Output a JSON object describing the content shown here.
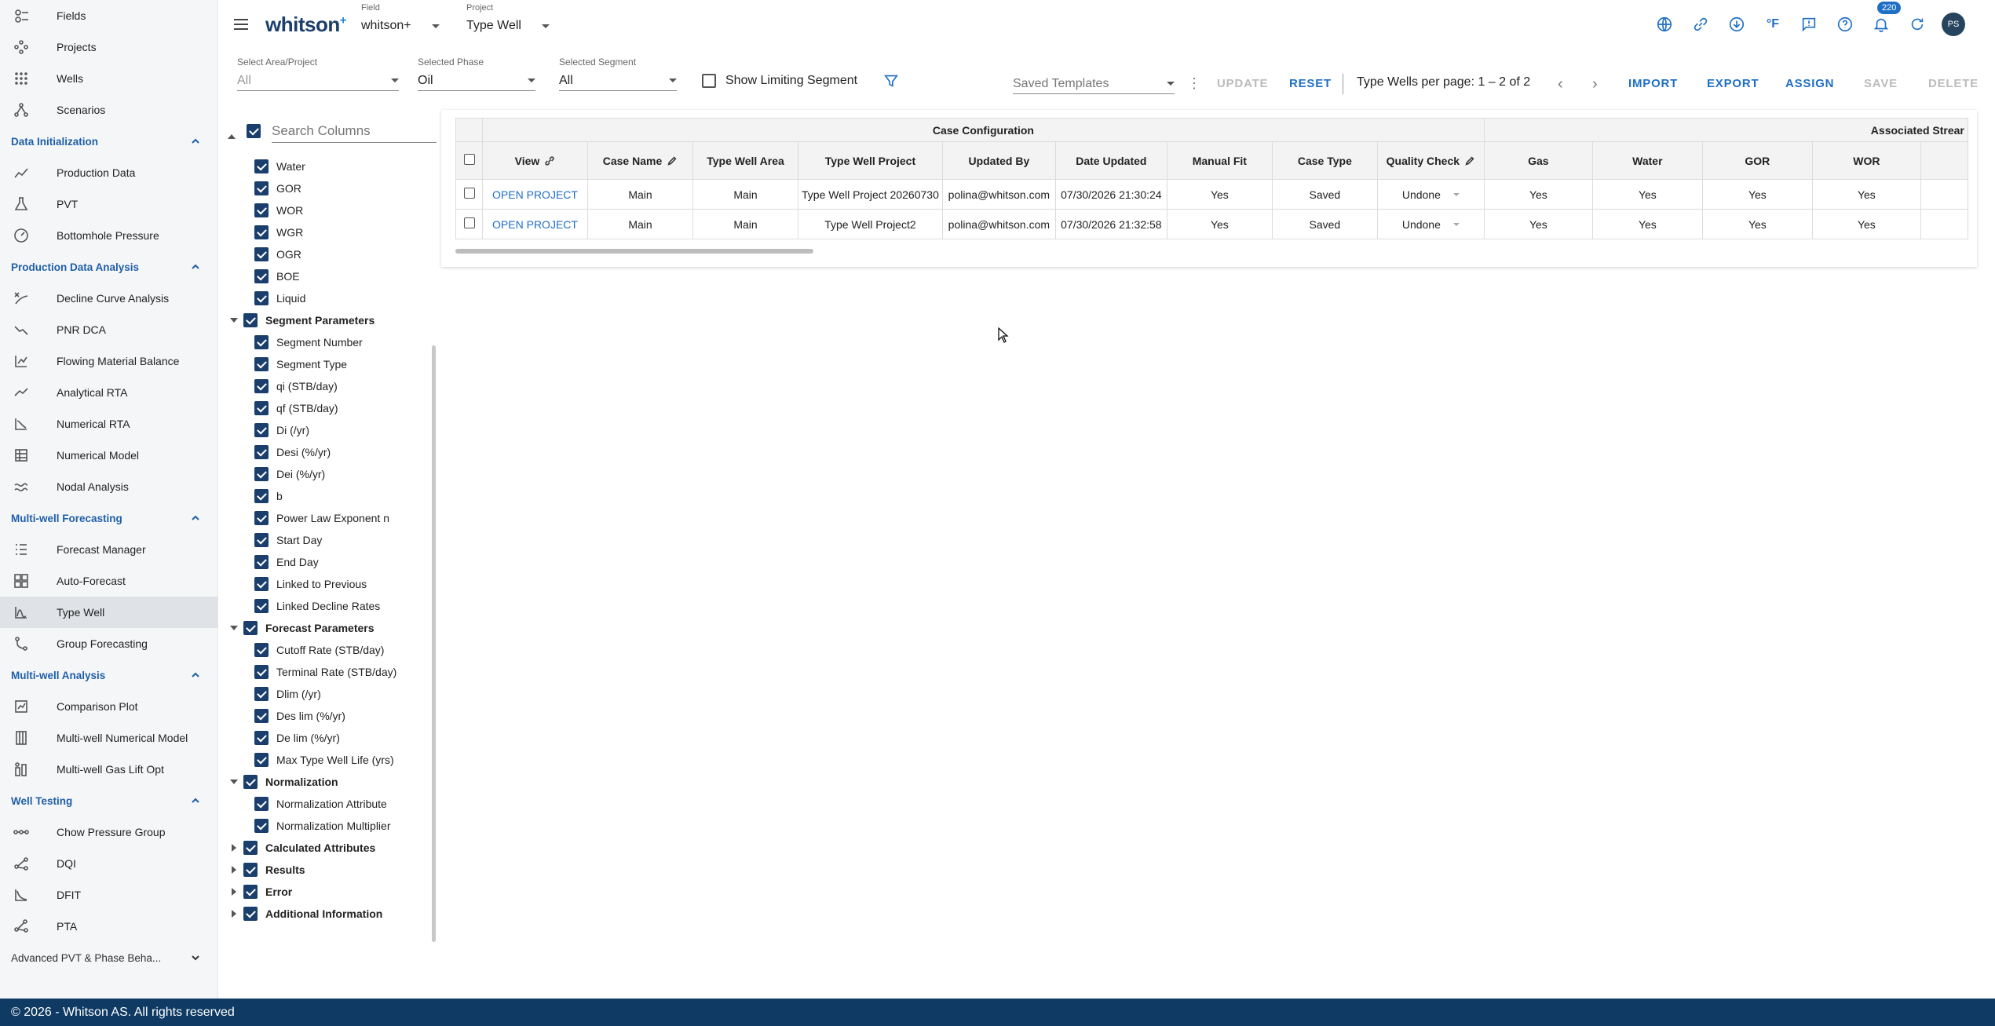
{
  "sidebar": {
    "top_items": [
      {
        "label": "Fields",
        "icon": "fields-icon"
      },
      {
        "label": "Projects",
        "icon": "projects-icon"
      },
      {
        "label": "Wells",
        "icon": "wells-icon"
      },
      {
        "label": "Scenarios",
        "icon": "scenarios-icon"
      }
    ],
    "sections": [
      {
        "title": "Data Initialization",
        "items": [
          {
            "label": "Production Data",
            "icon": "line-chart-icon"
          },
          {
            "label": "PVT",
            "icon": "flask-icon"
          },
          {
            "label": "Bottomhole Pressure",
            "icon": "gauge-icon"
          }
        ]
      },
      {
        "title": "Production Data Analysis",
        "items": [
          {
            "label": "Decline Curve Analysis",
            "icon": "decline-icon"
          },
          {
            "label": "PNR DCA",
            "icon": "trend-down-icon"
          },
          {
            "label": "Flowing Material Balance",
            "icon": "fmb-icon"
          },
          {
            "label": "Analytical RTA",
            "icon": "trend-icon"
          },
          {
            "label": "Numerical RTA",
            "icon": "numerical-rta-icon"
          },
          {
            "label": "Numerical Model",
            "icon": "grid-model-icon"
          },
          {
            "label": "Nodal Analysis",
            "icon": "nodal-icon"
          }
        ]
      },
      {
        "title": "Multi-well Forecasting",
        "items": [
          {
            "label": "Forecast Manager",
            "icon": "list-icon"
          },
          {
            "label": "Auto-Forecast",
            "icon": "auto-forecast-icon"
          },
          {
            "label": "Type Well",
            "icon": "type-well-icon",
            "active": true
          },
          {
            "label": "Group Forecasting",
            "icon": "group-icon"
          }
        ]
      },
      {
        "title": "Multi-well Analysis",
        "items": [
          {
            "label": "Comparison Plot",
            "icon": "comparison-icon"
          },
          {
            "label": "Multi-well Numerical Model",
            "icon": "multi-numerical-icon"
          },
          {
            "label": "Multi-well Gas Lift Opt",
            "icon": "gas-lift-icon"
          }
        ]
      },
      {
        "title": "Well Testing",
        "items": [
          {
            "label": "Chow Pressure Group",
            "icon": "chow-icon"
          },
          {
            "label": "DQI",
            "icon": "dqi-icon"
          },
          {
            "label": "DFIT",
            "icon": "dfit-icon"
          },
          {
            "label": "PTA",
            "icon": "pta-icon"
          }
        ]
      }
    ],
    "collapsed_section": "Advanced PVT & Phase Beha..."
  },
  "topbar": {
    "logo": "whitson",
    "logo_sup": "+",
    "field_label": "Field",
    "field_value": "whitson+",
    "project_label": "Project",
    "project_value": "Type Well",
    "temperature_unit": "°F",
    "notifications_count": "220",
    "avatar_initials": "PS"
  },
  "filters": {
    "area_label": "Select Area/Project",
    "area_value": "All",
    "phase_label": "Selected Phase",
    "phase_value": "Oil",
    "segment_label": "Selected Segment",
    "segment_value": "All",
    "show_limiting_segment": "Show Limiting Segment",
    "saved_templates": "Saved Templates",
    "update": "UPDATE",
    "reset": "RESET",
    "pager": "Type Wells per page: 1 – 2 of 2",
    "import": "IMPORT",
    "export": "EXPORT",
    "assign": "ASSIGN",
    "save": "SAVE",
    "delete": "DELETE"
  },
  "columns_panel": {
    "search_placeholder": "Search Columns",
    "groups": [
      {
        "label": null,
        "expanded": true,
        "children": [
          "Water",
          "GOR",
          "WOR",
          "WGR",
          "OGR",
          "BOE",
          "Liquid"
        ]
      },
      {
        "label": "Segment Parameters",
        "expanded": true,
        "children": [
          "Segment Number",
          "Segment Type",
          "qi (STB/day)",
          "qf (STB/day)",
          "Di (/yr)",
          "Desi (%/yr)",
          "Dei (%/yr)",
          "b",
          "Power Law Exponent n",
          "Start Day",
          "End Day",
          "Linked to Previous",
          "Linked Decline Rates"
        ]
      },
      {
        "label": "Forecast Parameters",
        "expanded": true,
        "children": [
          "Cutoff Rate (STB/day)",
          "Terminal Rate (STB/day)",
          "Dlim (/yr)",
          "Des lim (%/yr)",
          "De lim (%/yr)",
          "Max Type Well Life (yrs)"
        ]
      },
      {
        "label": "Normalization",
        "expanded": true,
        "children": [
          "Normalization Attribute",
          "Normalization Multiplier"
        ]
      },
      {
        "label": "Calculated Attributes",
        "expanded": false,
        "children": []
      },
      {
        "label": "Results",
        "expanded": false,
        "children": []
      },
      {
        "label": "Error",
        "expanded": false,
        "children": []
      },
      {
        "label": "Additional Information",
        "expanded": false,
        "children": []
      }
    ]
  },
  "table": {
    "group_headers": {
      "case_configuration": "Case Configuration",
      "associated_streams": "Associated Strear"
    },
    "headers": [
      "View",
      "Case Name",
      "Type Well Area",
      "Type Well Project",
      "Updated By",
      "Date Updated",
      "Manual Fit",
      "Case Type",
      "Quality Check",
      "Gas",
      "Water",
      "GOR",
      "WOR"
    ],
    "rows": [
      [
        "OPEN PROJECT",
        "Main",
        "Main",
        "Type Well Project 20260730",
        "polina@whitson.com",
        "07/30/2026 21:30:24",
        "Yes",
        "Saved",
        "Undone",
        "Yes",
        "Yes",
        "Yes",
        "Yes"
      ],
      [
        "OPEN PROJECT",
        "Main",
        "Main",
        "Type Well Project2",
        "polina@whitson.com",
        "07/30/2026 21:32:58",
        "Yes",
        "Saved",
        "Undone",
        "Yes",
        "Yes",
        "Yes",
        "Yes"
      ]
    ]
  },
  "footer": {
    "text": "© 2026 - Whitson AS. All rights reserved"
  }
}
